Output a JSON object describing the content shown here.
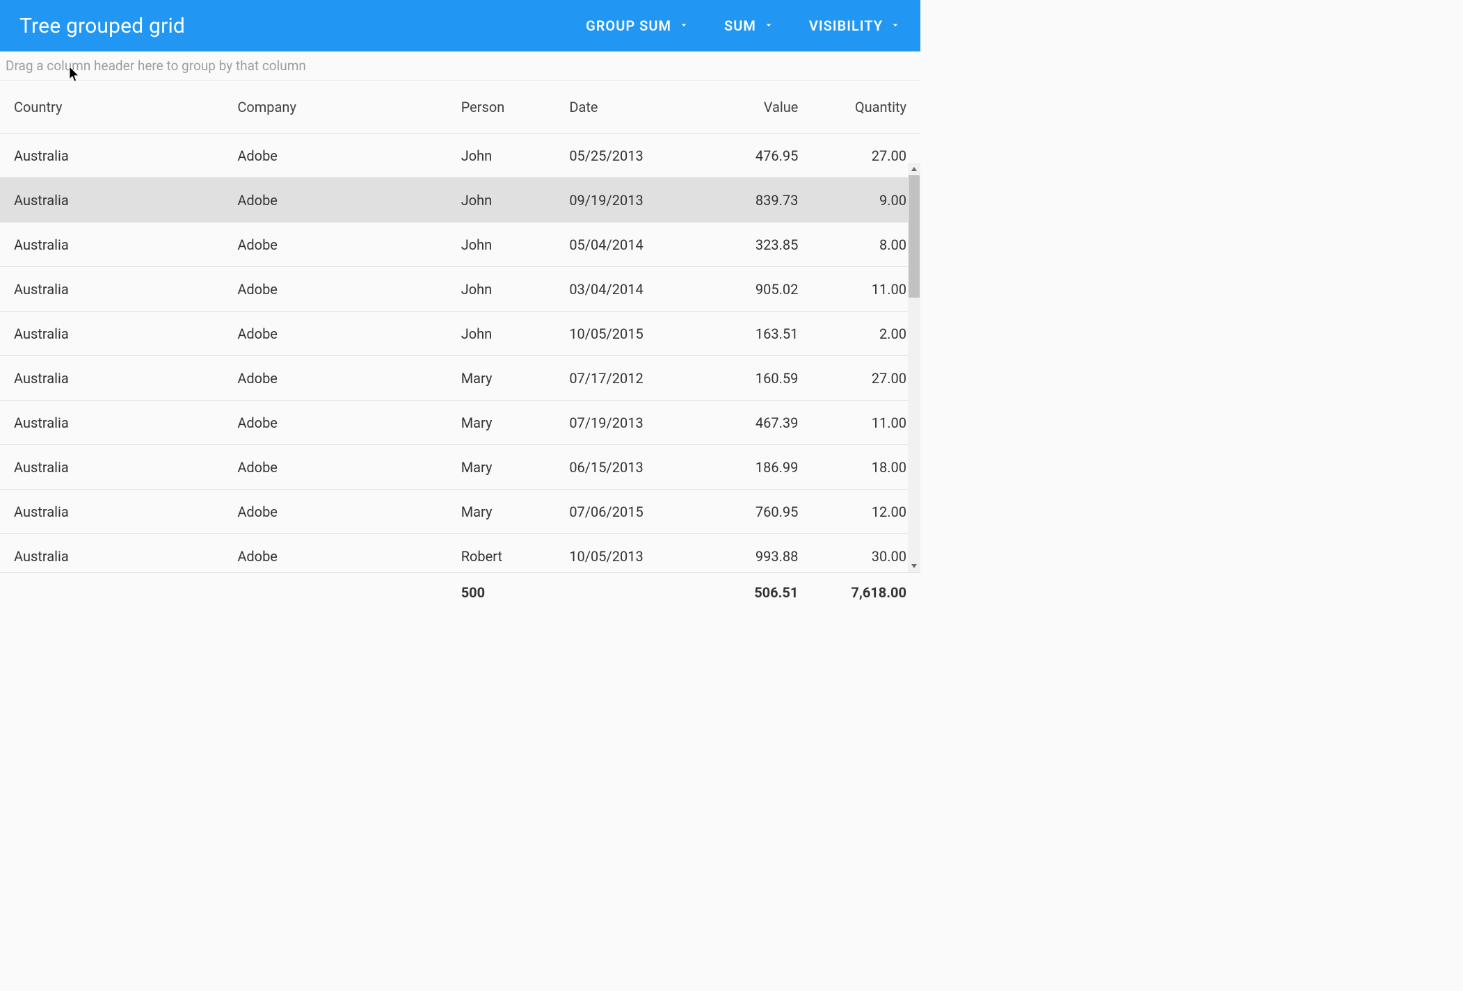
{
  "header": {
    "title": "Tree grouped grid",
    "buttons": {
      "group_sum": "GROUP SUM",
      "sum": "SUM",
      "visibility": "VISIBILITY"
    }
  },
  "group_bar": {
    "placeholder": "Drag a column header here to group by that column"
  },
  "columns": {
    "country": "Country",
    "company": "Company",
    "person": "Person",
    "date": "Date",
    "value": "Value",
    "quantity": "Quantity"
  },
  "rows": [
    {
      "country": "Australia",
      "company": "Adobe",
      "person": "John",
      "date": "05/25/2013",
      "value": "476.95",
      "quantity": "27.00",
      "hovered": false
    },
    {
      "country": "Australia",
      "company": "Adobe",
      "person": "John",
      "date": "09/19/2013",
      "value": "839.73",
      "quantity": "9.00",
      "hovered": true
    },
    {
      "country": "Australia",
      "company": "Adobe",
      "person": "John",
      "date": "05/04/2014",
      "value": "323.85",
      "quantity": "8.00",
      "hovered": false
    },
    {
      "country": "Australia",
      "company": "Adobe",
      "person": "John",
      "date": "03/04/2014",
      "value": "905.02",
      "quantity": "11.00",
      "hovered": false
    },
    {
      "country": "Australia",
      "company": "Adobe",
      "person": "John",
      "date": "10/05/2015",
      "value": "163.51",
      "quantity": "2.00",
      "hovered": false
    },
    {
      "country": "Australia",
      "company": "Adobe",
      "person": "Mary",
      "date": "07/17/2012",
      "value": "160.59",
      "quantity": "27.00",
      "hovered": false
    },
    {
      "country": "Australia",
      "company": "Adobe",
      "person": "Mary",
      "date": "07/19/2013",
      "value": "467.39",
      "quantity": "11.00",
      "hovered": false
    },
    {
      "country": "Australia",
      "company": "Adobe",
      "person": "Mary",
      "date": "06/15/2013",
      "value": "186.99",
      "quantity": "18.00",
      "hovered": false
    },
    {
      "country": "Australia",
      "company": "Adobe",
      "person": "Mary",
      "date": "07/06/2015",
      "value": "760.95",
      "quantity": "12.00",
      "hovered": false
    },
    {
      "country": "Australia",
      "company": "Adobe",
      "person": "Robert",
      "date": "10/05/2013",
      "value": "993.88",
      "quantity": "30.00",
      "hovered": false
    }
  ],
  "footer": {
    "person": "500",
    "value": "506.51",
    "quantity": "7,618.00"
  }
}
